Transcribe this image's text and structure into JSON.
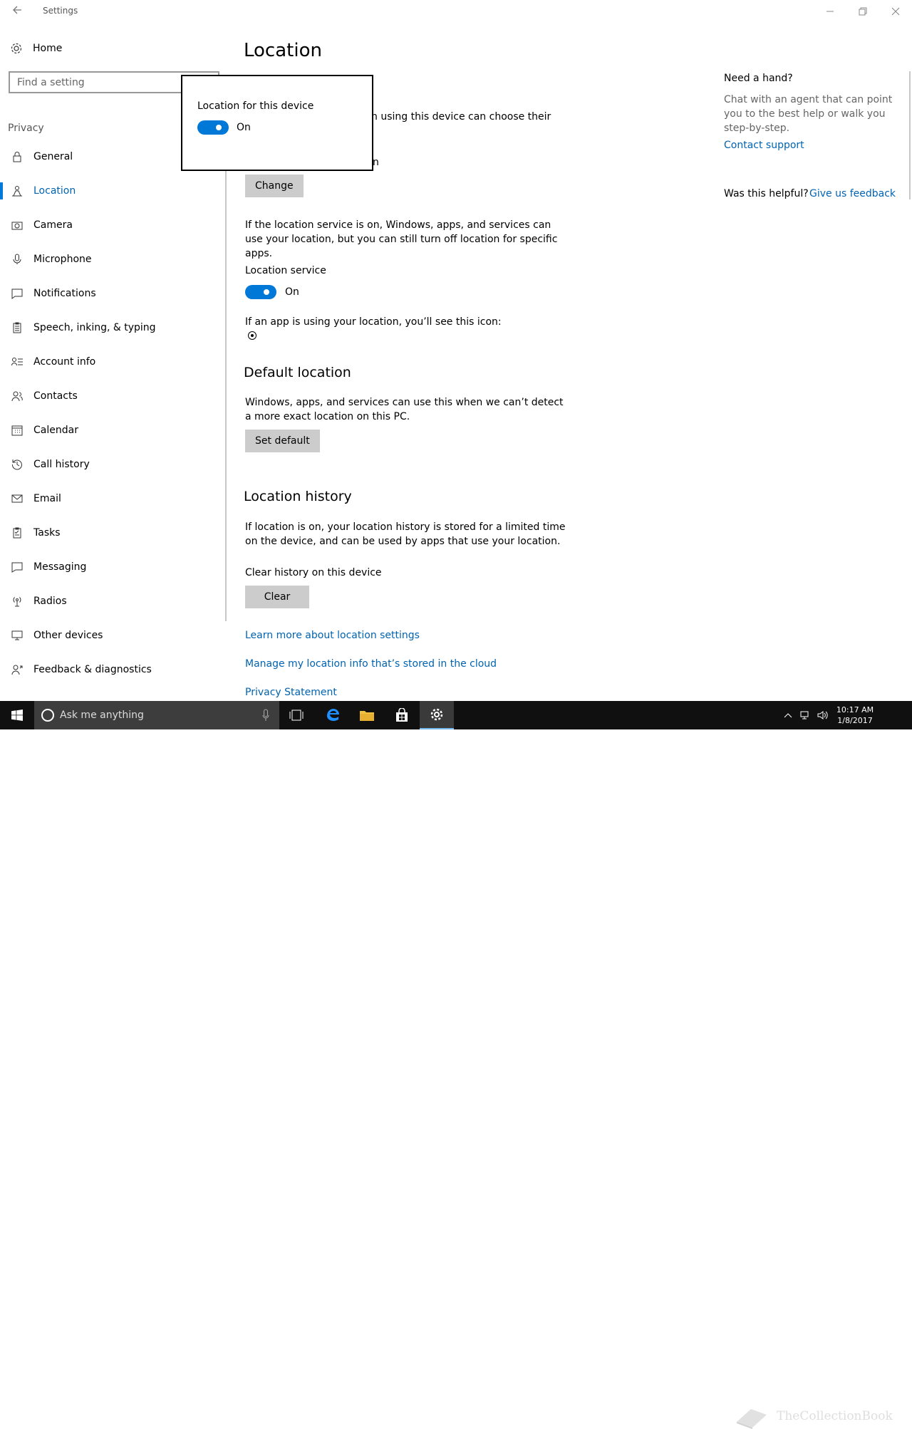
{
  "window": {
    "title": "Settings"
  },
  "sidebar": {
    "home_label": "Home",
    "search_placeholder": "Find a setting",
    "section_label": "Privacy",
    "items": [
      {
        "label": "General",
        "icon": "lock-icon"
      },
      {
        "label": "Location",
        "icon": "location-person-icon",
        "active": true
      },
      {
        "label": "Camera",
        "icon": "camera-icon"
      },
      {
        "label": "Microphone",
        "icon": "microphone-icon"
      },
      {
        "label": "Notifications",
        "icon": "notification-icon"
      },
      {
        "label": "Speech, inking, & typing",
        "icon": "clipboard-icon"
      },
      {
        "label": "Account info",
        "icon": "account-list-icon"
      },
      {
        "label": "Contacts",
        "icon": "contacts-icon"
      },
      {
        "label": "Calendar",
        "icon": "calendar-icon"
      },
      {
        "label": "Call history",
        "icon": "history-icon"
      },
      {
        "label": "Email",
        "icon": "mail-icon"
      },
      {
        "label": "Tasks",
        "icon": "tasks-icon"
      },
      {
        "label": "Messaging",
        "icon": "message-icon"
      },
      {
        "label": "Radios",
        "icon": "radio-tower-icon"
      },
      {
        "label": "Other devices",
        "icon": "devices-icon"
      },
      {
        "label": "Feedback & diagnostics",
        "icon": "feedback-icon"
      }
    ]
  },
  "main": {
    "page_title": "Location",
    "intro_fragment": "n using this device can choose their",
    "device_line_fragment": "n",
    "change_button": "Change",
    "service_desc": "If the location service is on, Windows, apps, and services can use your location, but you can still turn off location for specific apps.",
    "service_label": "Location service",
    "service_state": "On",
    "icon_notice": "If an app is using your location, you’ll see this icon:",
    "default_heading": "Default location",
    "default_desc": "Windows, apps, and services can use this when we can’t detect a more exact location on this PC.",
    "set_default_button": "Set default",
    "history_heading": "Location history",
    "history_desc": "If location is on, your location history is stored for a limited time on the device, and can be used by apps that use your location.",
    "clear_label": "Clear history on this device",
    "clear_button": "Clear",
    "link_learn": "Learn more about location settings",
    "link_manage": "Manage my location info that’s stored in the cloud",
    "link_privacy": "Privacy Statement"
  },
  "popup": {
    "title": "Location for this device",
    "state": "On"
  },
  "help": {
    "heading": "Need a hand?",
    "desc": "Chat with an agent that can point you to the best help or walk you step-by-step.",
    "contact_link": "Contact support",
    "helpful_label": "Was this helpful?",
    "feedback_link": "Give us feedback"
  },
  "taskbar": {
    "search_placeholder": "Ask me anything",
    "time": "10:17 AM",
    "date": "1/8/2017",
    "watermark": "TheCollectionBook"
  },
  "colors": {
    "accent": "#0078d7",
    "link": "#0063b1"
  }
}
